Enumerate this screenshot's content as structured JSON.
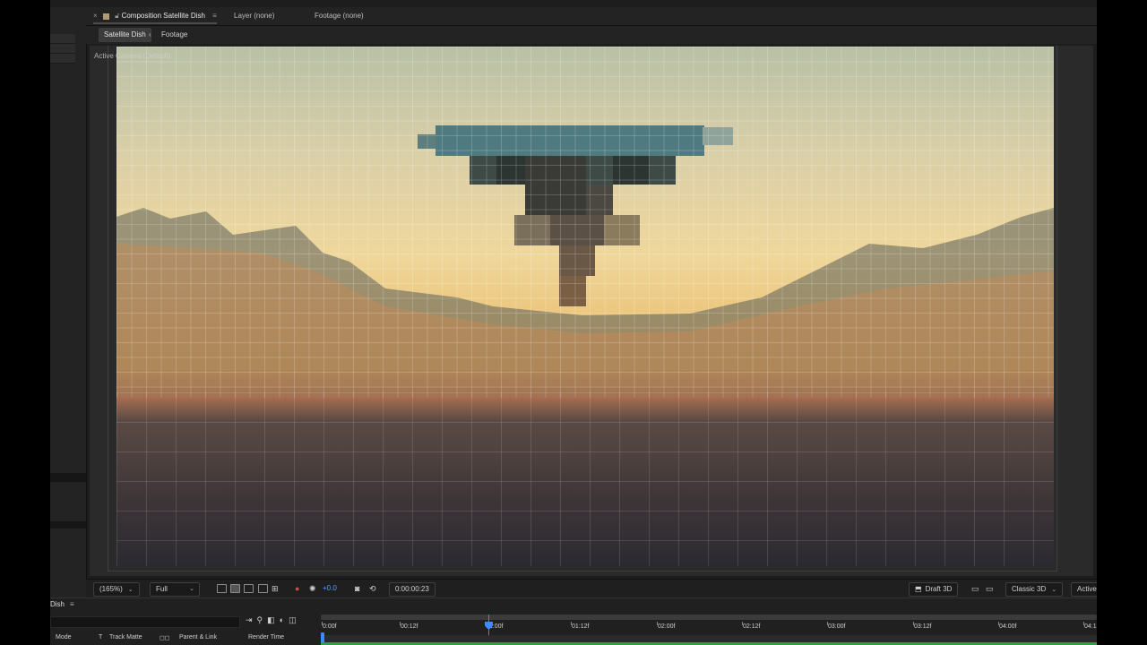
{
  "tabs": {
    "composition_label": "Composition Satellite Dish",
    "layer_label": "Layer (none)",
    "footage_label": "Footage (none)"
  },
  "crumbs": {
    "active": "Satellite Dish",
    "footage": "Footage"
  },
  "viewer": {
    "camera_label": "Active Camera (Default)"
  },
  "footer": {
    "zoom": "(165%)",
    "resolution": "Full",
    "exposure": "+0.0",
    "timecode": "0:00:00:23",
    "renderer_mode": "Draft 3D",
    "renderer": "Classic 3D",
    "view": "Active C"
  },
  "timeline": {
    "title": "Dish",
    "columns": {
      "mode": "Mode",
      "t": "T",
      "track_matte": "Track Matte",
      "parent": "Parent & Link",
      "render_time": "Render Time"
    },
    "ruler_ticks": [
      "0:00f",
      "00:12f",
      "01:00f",
      "01:12f",
      "02:00f",
      "02:12f",
      "03:00f",
      "03:12f",
      "04:00f",
      "04:1"
    ],
    "playhead_time": "01:00f"
  },
  "colors": {
    "accent_blue": "#3d8bff",
    "work_area_green": "#27a34a",
    "panel_bg": "#1d1d1d"
  }
}
